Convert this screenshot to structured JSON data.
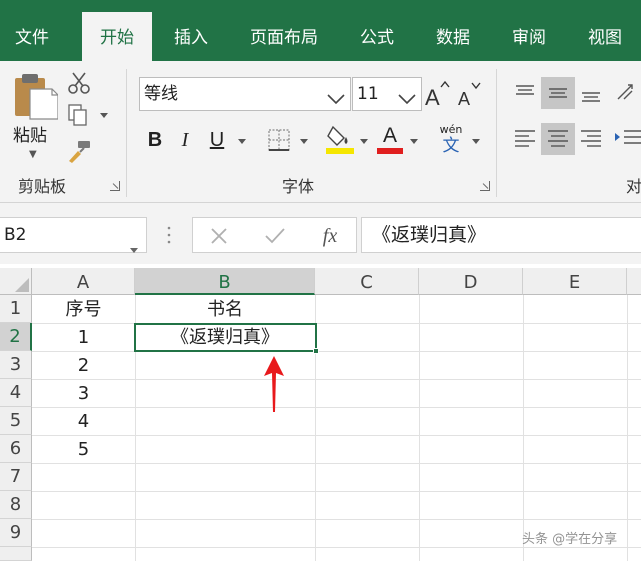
{
  "tabs": [
    {
      "label": "文件"
    },
    {
      "label": "开始"
    },
    {
      "label": "插入"
    },
    {
      "label": "页面布局"
    },
    {
      "label": "公式"
    },
    {
      "label": "数据"
    },
    {
      "label": "审阅"
    },
    {
      "label": "视图"
    }
  ],
  "ribbon": {
    "paste_label": "粘贴",
    "clipboard_group": "剪贴板",
    "font_group": "字体",
    "align_group_partial": "对",
    "font_name": "等线",
    "font_size": "11",
    "bold": "B",
    "italic": "I",
    "underline": "U",
    "font_color_glyph": "A",
    "phonetic_top": "wén",
    "phonetic_bottom": "文",
    "highlight_color": "#f5e600",
    "font_color": "#e01e1e"
  },
  "formula_bar": {
    "name_box": "B2",
    "fx": "fx",
    "content": "《返璞归真》"
  },
  "sheet": {
    "columns": [
      "A",
      "B",
      "C",
      "D",
      "E"
    ],
    "rows": [
      "1",
      "2",
      "3",
      "4",
      "5",
      "6",
      "7",
      "8",
      "9"
    ],
    "selected_cell": "B2",
    "cells": {
      "A1": "序号",
      "B1": "书名",
      "A2": "1",
      "B2": "《返璞归真》",
      "A3": "2",
      "A4": "3",
      "A5": "4",
      "A6": "5"
    },
    "accent": "#217346",
    "annotation_color": "#e8191c"
  },
  "watermark": "头条 @学在分享"
}
